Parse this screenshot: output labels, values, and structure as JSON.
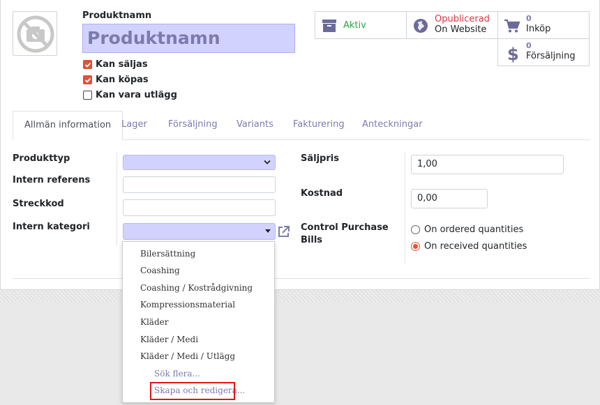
{
  "header": {
    "name_label": "Produktnamn",
    "name_placeholder": "Produktnamn",
    "checkboxes": [
      {
        "label": "Kan säljas",
        "checked": true
      },
      {
        "label": "Kan köpas",
        "checked": true
      },
      {
        "label": "Kan vara utlägg",
        "checked": false
      }
    ]
  },
  "smart_buttons": {
    "active": {
      "label": "Aktiv",
      "icon": "archive-icon"
    },
    "website": {
      "line1": "Opublicerad",
      "line2": "On Website",
      "icon": "globe-icon"
    },
    "purchase": {
      "count": "0",
      "label": "Inköp",
      "icon": "cart-icon"
    },
    "sales": {
      "count": "0",
      "label": "Försäljning",
      "icon": "dollar-icon"
    }
  },
  "tabs": [
    {
      "label": "Allmän information",
      "active": true
    },
    {
      "label": "Lager"
    },
    {
      "label": "Försäljning"
    },
    {
      "label": "Variants"
    },
    {
      "label": "Fakturering"
    },
    {
      "label": "Anteckningar"
    }
  ],
  "form": {
    "product_type_label": "Produkttyp",
    "product_type_value": "",
    "internal_ref_label": "Intern referens",
    "internal_ref_value": "",
    "barcode_label": "Streckkod",
    "barcode_value": "",
    "category_label": "Intern kategori",
    "category_value": "",
    "sale_price_label": "Säljpris",
    "sale_price_value": "1,00",
    "cost_label": "Kostnad",
    "cost_value": "0,00",
    "control_label_1": "Control Purchase",
    "control_label_2": "Bills",
    "control_options": [
      {
        "label": "On ordered quantities",
        "selected": false
      },
      {
        "label": "On received quantities",
        "selected": true
      }
    ]
  },
  "dropdown": {
    "items": [
      "Bilersättning",
      "Coashing",
      "Coashing / Kostrådgivning",
      "Kompressionsmaterial",
      "Kläder",
      "Kläder / Medi",
      "Kläder / Medi / Utlägg"
    ],
    "search_more": "Sök flera...",
    "create_edit": "Skapa och redigera..."
  },
  "colors": {
    "brand_purple": "#7c7bad",
    "required_field": "#d2d2ff",
    "checkbox_accent": "#e0533b",
    "highlight_red": "#e01515"
  }
}
